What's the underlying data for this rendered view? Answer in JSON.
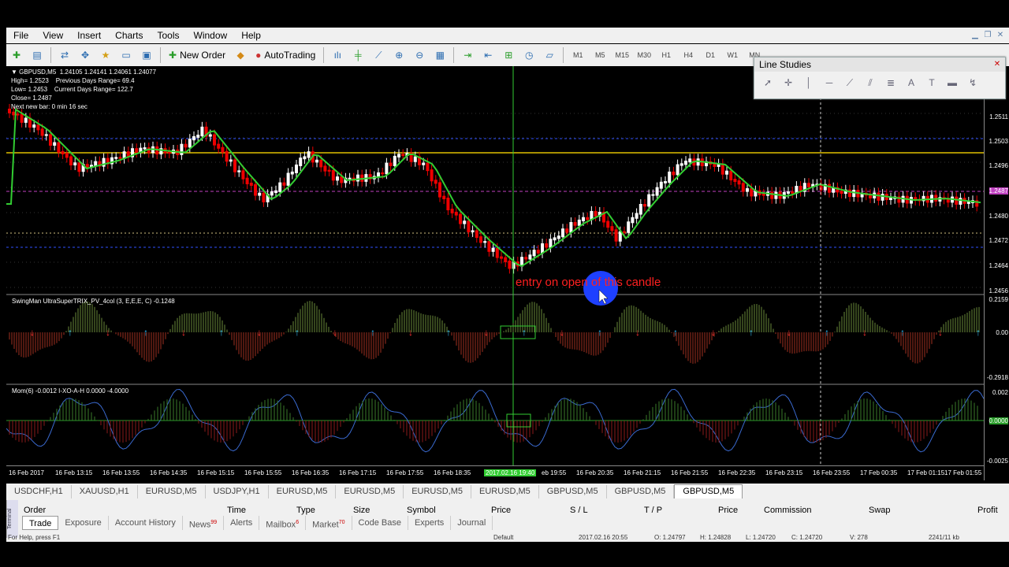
{
  "menu": [
    "File",
    "View",
    "Insert",
    "Charts",
    "Tools",
    "Window",
    "Help"
  ],
  "toolbar": {
    "new_order": "New Order",
    "autotrading": "AutoTrading",
    "timeframes": [
      "M1",
      "M5",
      "M15",
      "M30",
      "H1",
      "H4",
      "D1",
      "W1",
      "MN"
    ]
  },
  "chart": {
    "ohlc": "▼ GBPUSD,M5  1.24105 1.24141 1.24061 1.24077",
    "info": [
      "High= 1.2523    Previous Days Range= 69.4",
      "Low= 1.2453    Current Days Range= 122.7",
      "Close= 1.2487",
      "Next new bar: 0 min 16 sec"
    ],
    "annotation": "entry on open of this candle",
    "price_labels": [
      "1.2511",
      "1.2503",
      "1.2496",
      "1.2487",
      "1.2480",
      "1.2472",
      "1.2464",
      "1.2456"
    ],
    "sub1_label": "SwingMan UltraSuperTRIX_PV_4col (3, E,E,E, C) -0.1248",
    "sub1_labels": [
      "0.2159",
      "0.00",
      "-0.2918"
    ],
    "sub2_label": "Mom(6) -0.0012  I-XO-A-H 0.0000 -4.0000",
    "sub2_labels": [
      "0.002",
      "0.0000",
      "-0.0025"
    ],
    "time_labels": [
      "16 Feb 2017",
      "16 Feb 13:15",
      "16 Feb 13:55",
      "16 Feb 14:35",
      "16 Feb 15:15",
      "16 Feb 15:55",
      "16 Feb 16:35",
      "16 Feb 17:15",
      "16 Feb 17:55",
      "16 Feb 18:35",
      "2017.02.16 19:40",
      "eb 19:55",
      "16 Feb 20:35",
      "16 Feb 21:15",
      "16 Feb 21:55",
      "16 Feb 22:35",
      "16 Feb 23:15",
      "16 Feb 23:55",
      "17 Feb 00:35",
      "17 Feb 01:15",
      "17 Feb 01:55"
    ]
  },
  "line_studies": {
    "title": "Line Studies"
  },
  "chart_tabs": [
    "USDCHF,H1",
    "XAUUSD,H1",
    "EURUSD,M5",
    "USDJPY,H1",
    "EURUSD,M5",
    "EURUSD,M5",
    "EURUSD,M5",
    "EURUSD,M5",
    "GBPUSD,M5",
    "GBPUSD,M5",
    "GBPUSD,M5"
  ],
  "terminal": {
    "side": "Terminal",
    "columns": [
      "Order",
      "Time",
      "Type",
      "Size",
      "Symbol",
      "Price",
      "S / L",
      "T / P",
      "Price",
      "Commission",
      "Swap",
      "Profit"
    ],
    "tabs": [
      {
        "label": "Trade",
        "badge": ""
      },
      {
        "label": "Exposure",
        "badge": ""
      },
      {
        "label": "Account History",
        "badge": ""
      },
      {
        "label": "News",
        "badge": "99"
      },
      {
        "label": "Alerts",
        "badge": ""
      },
      {
        "label": "Mailbox",
        "badge": "6"
      },
      {
        "label": "Market",
        "badge": "70"
      },
      {
        "label": "Code Base",
        "badge": ""
      },
      {
        "label": "Experts",
        "badge": ""
      },
      {
        "label": "Journal",
        "badge": ""
      }
    ],
    "status": [
      "For Help, press F1",
      "Default",
      "2017.02.16 20:55",
      "O: 1.24797",
      "H: 1.24828",
      "L: 1.24720",
      "C: 1.24720",
      "V: 278",
      "2241/11 kb"
    ]
  }
}
